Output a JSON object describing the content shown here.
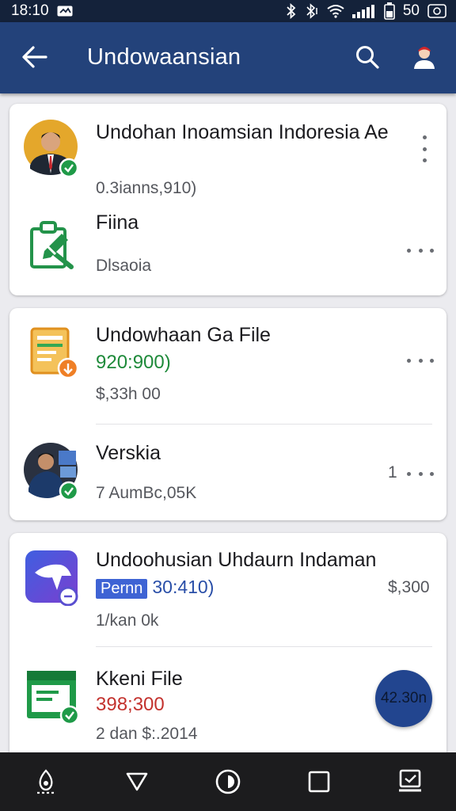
{
  "status_bar": {
    "time": "18:10",
    "battery_text": "50"
  },
  "app_bar": {
    "title": "Undowaansian"
  },
  "cards": [
    {
      "items": [
        {
          "title": "Undohan Inoamsian Indoresia Ae",
          "subtitle": "0.3ianns,910)",
          "thumb_icon": "person-avatar-icon"
        },
        {
          "title": "Fiina",
          "subtitle": "Dlsaoia",
          "thumb_icon": "clipboard-edit-icon"
        }
      ]
    },
    {
      "items": [
        {
          "title": "Undowhaan Ga File",
          "highlight": "920:900)",
          "subtitle": "$,33h 00",
          "thumb_icon": "document-icon"
        },
        {
          "title": "Verskia",
          "subtitle": "7 AumBc,05K",
          "count": "1",
          "thumb_icon": "person-photo-icon"
        }
      ]
    },
    {
      "items": [
        {
          "title": "Undoohusian Uhdaurn Indaman",
          "tag": "Pernn",
          "highlight": "30:410)",
          "amount": "$,300",
          "subtitle": "1/kan 0k",
          "thumb_icon": "app-logo-icon"
        },
        {
          "title": "Kkeni File",
          "highlight": "398;300",
          "subtitle": "2 dan $:.2014",
          "thumb_icon": "sheet-file-icon"
        }
      ]
    }
  ],
  "fab": {
    "label": "42.30n"
  },
  "colors": {
    "app_bar": "#23427a",
    "status_bar": "#14223a",
    "accent_green": "#1e8a3a",
    "accent_blue": "#2a4fa8",
    "accent_red": "#c3322e",
    "fab": "#22458f"
  }
}
